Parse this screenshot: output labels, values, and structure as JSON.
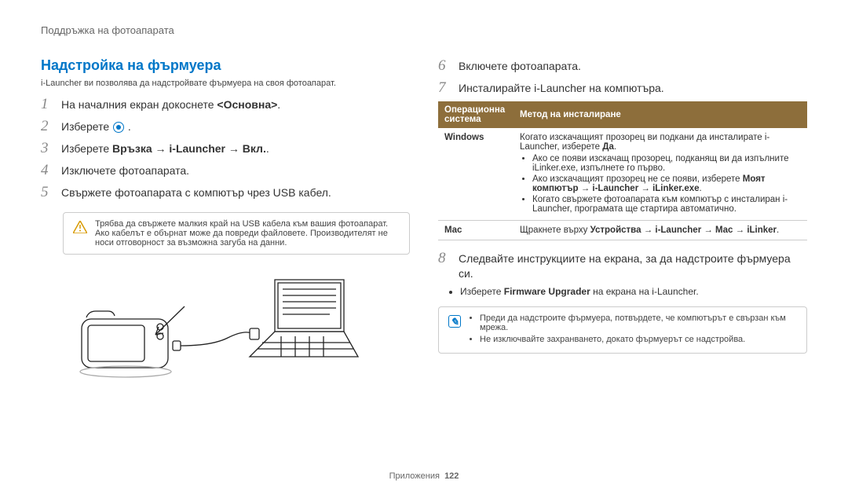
{
  "header": {
    "breadcrumb": "Поддръжка на фотоапарата"
  },
  "left": {
    "title": "Надстройка на фърмуера",
    "intro": "i-Launcher ви позволява да надстройвате фърмуера на своя фотоапарат.",
    "steps": {
      "s1": {
        "num": "1",
        "pre": "На началния екран докоснете ",
        "bold": "<Основна>",
        "post": "."
      },
      "s2": {
        "num": "2",
        "pre": "Изберете ",
        "post": " ."
      },
      "s3": {
        "num": "3",
        "pre": "Изберете ",
        "bold": "Връзка → i-Launcher → Вкл.",
        "post": "."
      },
      "s4": {
        "num": "4",
        "text": "Изключете фотоапарата."
      },
      "s5": {
        "num": "5",
        "text": "Свържете фотоапарата с компютър чрез USB кабел."
      }
    },
    "warn": "Трябва да свържете малкия край на USB кабела към вашия фотоапарат. Ако кабелът е обърнат може да повреди файловете. Производителят не носи отговорност за възможна загуба на данни."
  },
  "right": {
    "steps": {
      "s6": {
        "num": "6",
        "text": "Включете фотоапарата."
      },
      "s7": {
        "num": "7",
        "text": "Инсталирайте i-Launcher на компютъра."
      },
      "s8": {
        "num": "8",
        "text": "Следвайте инструкциите на екрана, за да надстроите фърмуера си."
      }
    },
    "table": {
      "head_os": "Операционна система",
      "head_method": "Метод на инсталиране",
      "windows_label": "Windows",
      "windows_intro_pre": "Когато изскачащият прозорец ви подкани да инсталирате i-Launcher, изберете ",
      "windows_intro_bold": "Да",
      "windows_intro_post": ".",
      "windows_b1": "Ако се появи изскачащ прозорец, подканящ ви да изпълните iLinker.exe, изпълнете го първо.",
      "windows_b2_pre": "Ако изскачащият прозорец не се появи, изберете ",
      "windows_b2_bold": "Моят компютър → i-Launcher → iLinker.exe",
      "windows_b2_post": ".",
      "windows_b3": "Когато свържете фотоапарата към компютър с инсталиран i-Launcher, програмата ще стартира автоматично.",
      "mac_label": "Mac",
      "mac_pre": "Щракнете върху ",
      "mac_bold": "Устройства → i-Launcher → Mac → iLinker",
      "mac_post": "."
    },
    "s8_sub_pre": "Изберете ",
    "s8_sub_bold": "Firmware Upgrader",
    "s8_sub_post": " на екрана на i-Launcher.",
    "info": {
      "b1": "Преди да надстроите фърмуера, потвърдете, че компютърът е свързан към мрежа.",
      "b2": "Не изключвайте захранването, докато фърмуерът се надстройва."
    }
  },
  "footer": {
    "label": "Приложения",
    "page": "122"
  }
}
